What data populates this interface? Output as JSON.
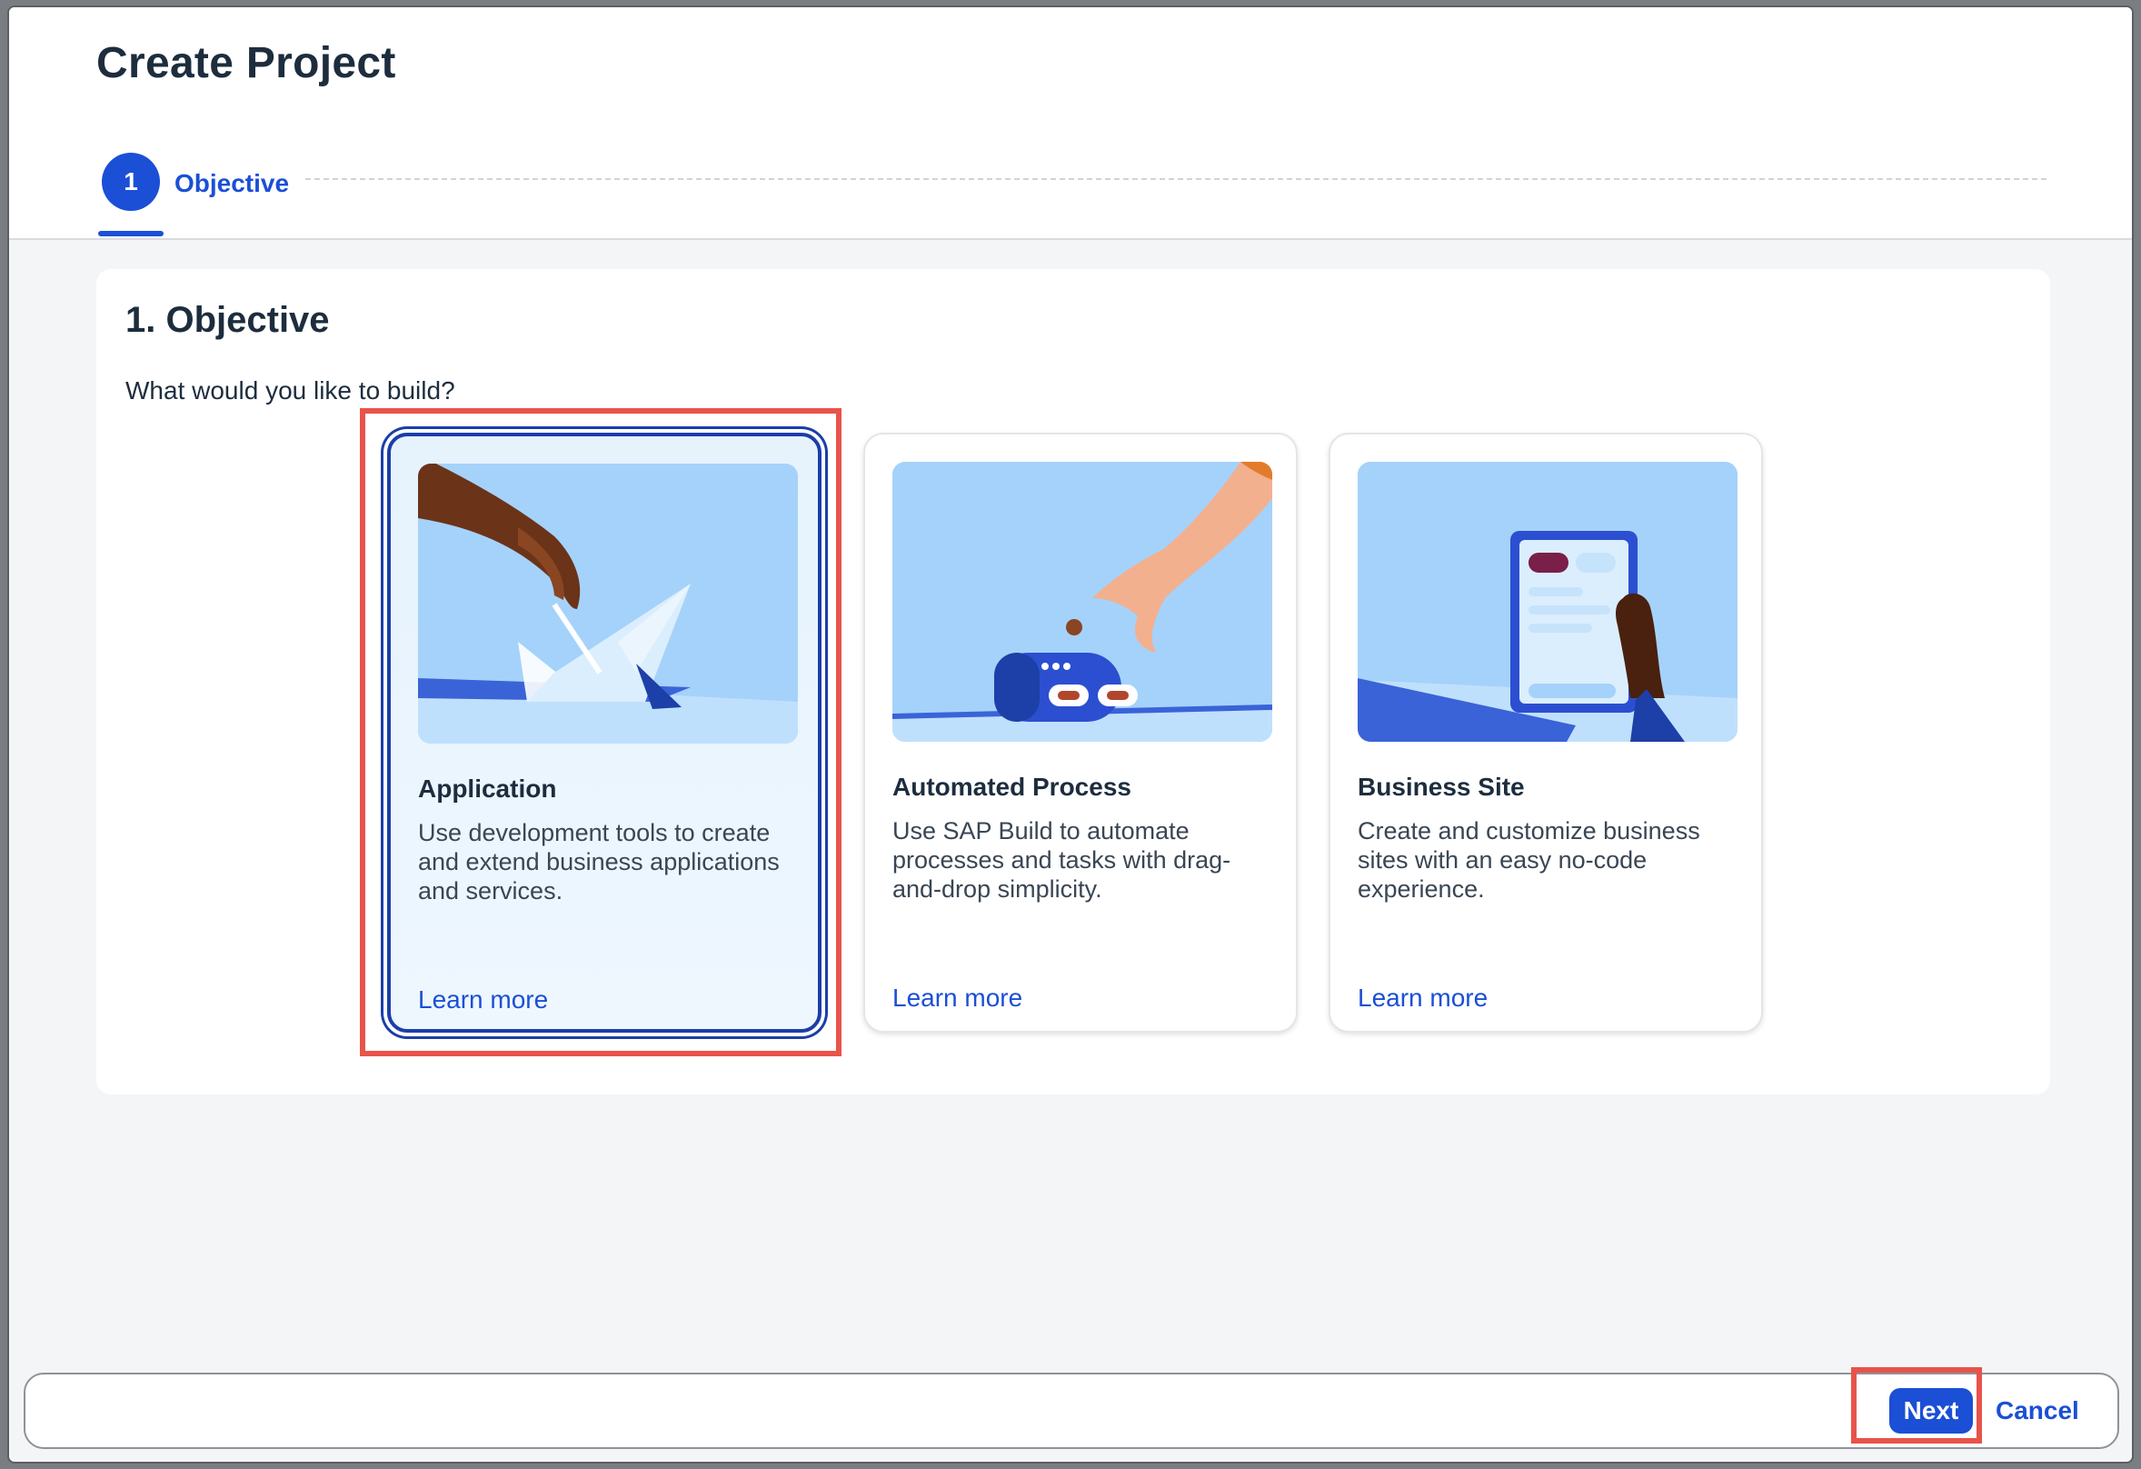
{
  "dialog": {
    "title": "Create Project"
  },
  "steps": [
    {
      "number": "1",
      "label": "Objective"
    }
  ],
  "section": {
    "title": "1. Objective",
    "question": "What would you like to build?"
  },
  "cards": [
    {
      "title": "Application",
      "description": "Use development tools to create and extend business applications and services.",
      "link": "Learn more",
      "selected": true
    },
    {
      "title": "Automated Process",
      "description": "Use SAP Build to automate processes and tasks with drag-and-drop simplicity.",
      "link": "Learn more",
      "selected": false
    },
    {
      "title": "Business Site",
      "description": "Create and customize business sites with an easy no-code experience.",
      "link": "Learn more",
      "selected": false
    }
  ],
  "footer": {
    "next_label": "Next",
    "cancel_label": "Cancel"
  },
  "colors": {
    "accent": "#1b4fd6",
    "highlight": "#e8534a"
  }
}
